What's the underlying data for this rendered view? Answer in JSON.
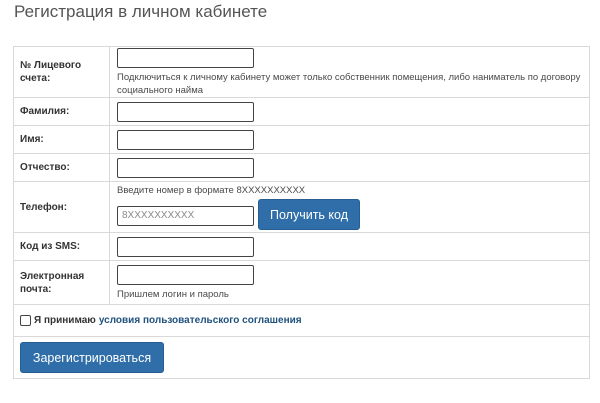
{
  "page": {
    "title": "Регистрация в личном кабинете"
  },
  "form": {
    "account": {
      "label": "№ Лицевого счета:",
      "value": "",
      "hint": "Подключиться к личному кабинету может только собственник помещения, либо наниматель по договору социального найма"
    },
    "last_name": {
      "label": "Фамилия:",
      "value": ""
    },
    "first_name": {
      "label": "Имя:",
      "value": ""
    },
    "middle_name": {
      "label": "Отчество:",
      "value": ""
    },
    "phone": {
      "label": "Телефон:",
      "hint": "Введите номер в формате 8XXXXXXXXXX",
      "placeholder": "8XXXXXXXXXX",
      "get_code_label": "Получить код"
    },
    "sms_code": {
      "label": "Код из SMS:",
      "value": ""
    },
    "email": {
      "label": "Электронная почта:",
      "value": "",
      "hint": "Пришлем логин и пароль"
    },
    "agreement": {
      "checked": false,
      "prefix": "Я принимаю",
      "link_text": "условия пользовательского соглашения"
    },
    "submit_label": "Зарегистрироваться"
  },
  "colors": {
    "button": "#2f6ea8",
    "link": "#21527e",
    "border": "#d9d9d9"
  }
}
